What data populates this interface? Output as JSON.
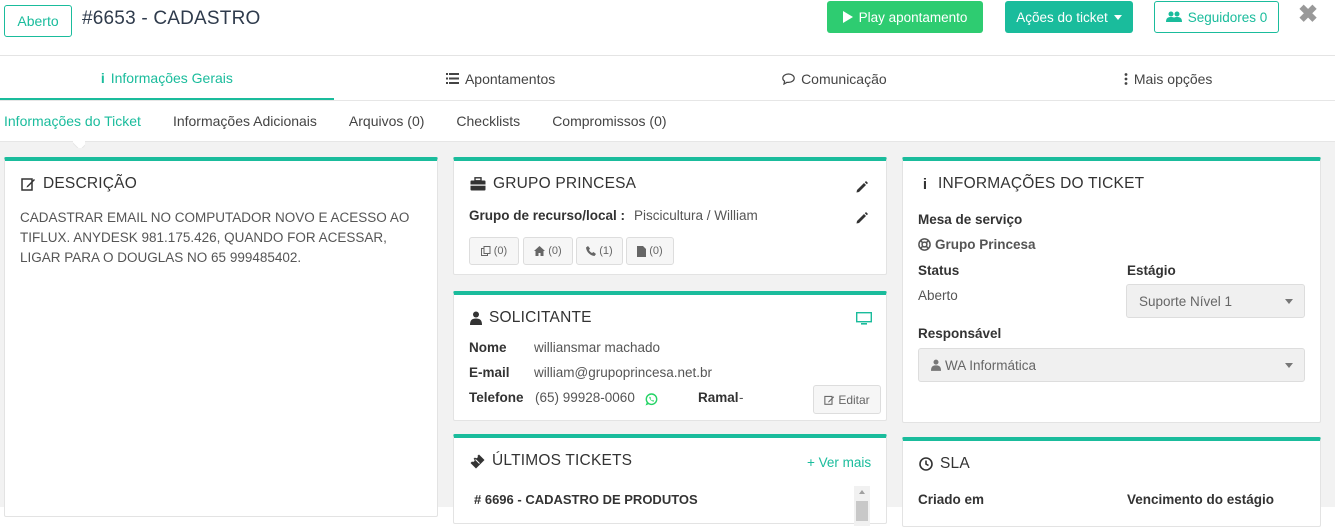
{
  "header": {
    "status": "Aberto",
    "title": "#6653 - CADASTRO",
    "play_label": "Play apontamento",
    "actions_label": "Ações do ticket",
    "followers_label": "Seguidores 0",
    "close_symbol": "✖"
  },
  "tabs": [
    {
      "label": "Informações Gerais"
    },
    {
      "label": "Apontamentos"
    },
    {
      "label": "Comunicação"
    },
    {
      "label": "Mais opções"
    }
  ],
  "subtabs": [
    {
      "label": "Informações do Ticket"
    },
    {
      "label": "Informações Adicionais"
    },
    {
      "label": "Arquivos (0)"
    },
    {
      "label": "Checklists"
    },
    {
      "label": "Compromissos (0)"
    }
  ],
  "descricao": {
    "title": "DESCRIÇÃO",
    "line1": "CADASTRAR EMAIL NO COMPUTADOR NOVO E ACESSO AO",
    "line2": "TIFLUX. ANYDESK 981.175.426, QUANDO FOR ACESSAR,",
    "line3": "LIGAR PARA O DOUGLAS NO 65 999485402."
  },
  "grupo": {
    "title": "GRUPO PRINCESA",
    "resource_label": "Grupo de recurso/local :",
    "resource_value": "Piscicultura / William",
    "counters": [
      "(0)",
      "(0)",
      "(1)",
      "(0)"
    ]
  },
  "solicitante": {
    "title": "SOLICITANTE",
    "nome_label": "Nome",
    "nome_value": "williansmar machado",
    "email_label": "E-mail",
    "email_value": "william@grupoprincesa.net.br",
    "telefone_label": "Telefone",
    "telefone_value": "(65) 99928-0060",
    "ramal_label": "Ramal",
    "ramal_value": "-",
    "edit_label": "Editar"
  },
  "ultimos": {
    "title": "ÚLTIMOS TICKETS",
    "more_label": "+ Ver mais",
    "first_item": "# 6696 - CADASTRO DE PRODUTOS"
  },
  "info_ticket": {
    "title": "INFORMAÇÕES DO TICKET",
    "mesa_label": "Mesa de serviço",
    "mesa_value": "Grupo Princesa",
    "status_label": "Status",
    "status_value": "Aberto",
    "estagio_label": "Estágio",
    "estagio_value": "Suporte Nível 1",
    "responsavel_label": "Responsável",
    "responsavel_value": "WA Informática"
  },
  "sla": {
    "title": "SLA",
    "criado_label": "Criado em",
    "vencimento_label": "Vencimento do estágio"
  },
  "colors": {
    "accent": "#1abc9c",
    "play": "#2ecc71",
    "whatsapp": "#25d366"
  }
}
